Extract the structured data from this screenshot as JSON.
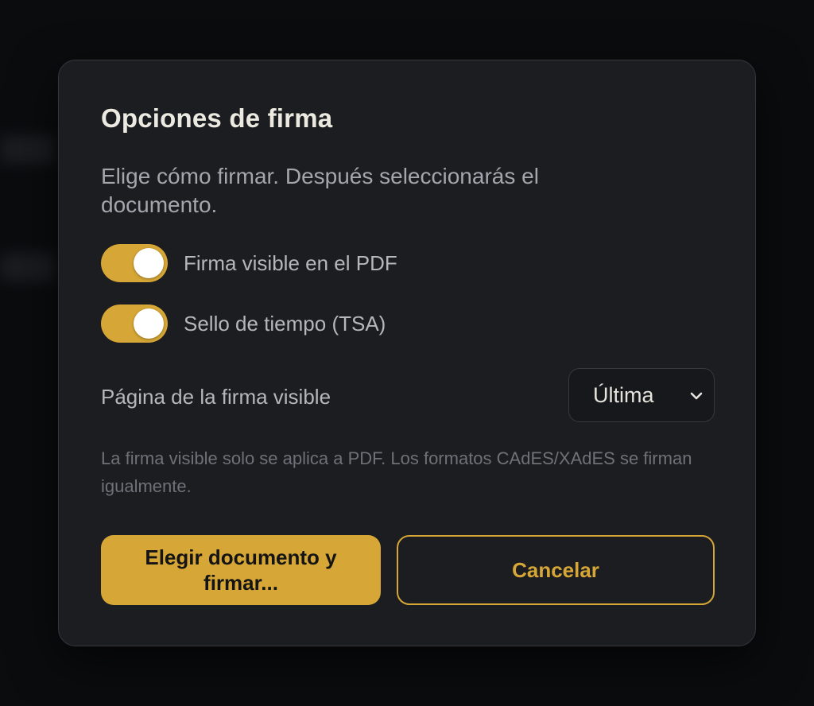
{
  "dialog": {
    "title": "Opciones de firma",
    "subtitle": "Elige cómo firmar. Después seleccionarás el documento.",
    "toggles": [
      {
        "label": "Firma visible en el PDF",
        "checked": true
      },
      {
        "label": "Sello de tiempo (TSA)",
        "checked": true
      }
    ],
    "page_select": {
      "label": "Página de la firma visible",
      "value": "Última"
    },
    "note": "La firma visible solo se aplica a PDF. Los formatos CAdES/XAdES se firman igualmente.",
    "primary_button": "Elegir documento y firmar...",
    "cancel_button": "Cancelar"
  },
  "colors": {
    "accent": "#d6a736",
    "dialog_bg": "#1b1d21",
    "page_bg": "#0b0c0e"
  },
  "icons": {
    "select_chevron": "chevron-down-icon"
  }
}
